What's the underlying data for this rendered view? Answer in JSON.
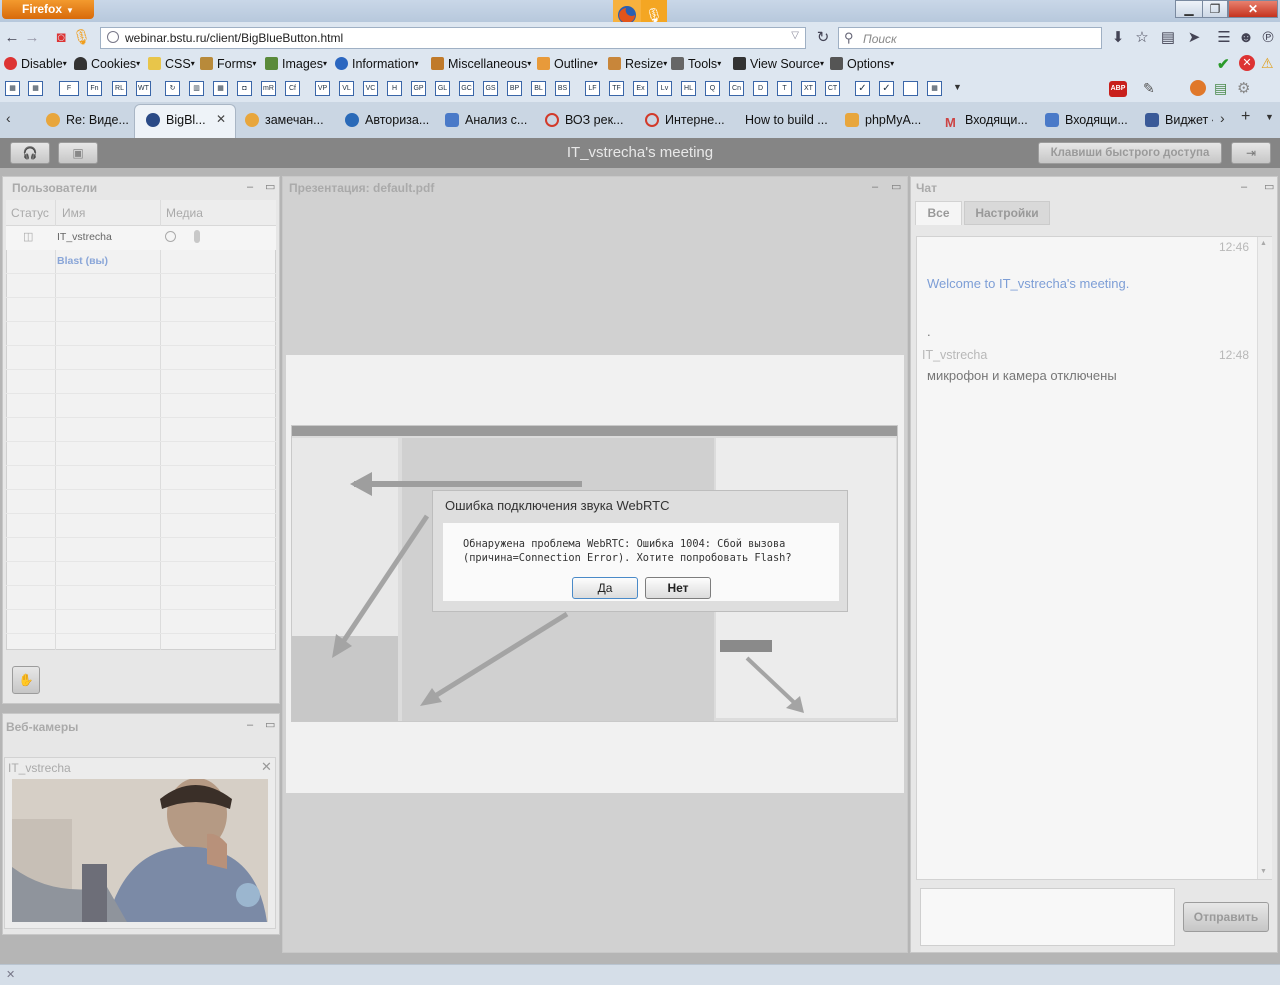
{
  "browser": {
    "firefox_button": "Firefox",
    "url": "webinar.bstu.ru/client/BigBlueButton.html",
    "search_placeholder": "Поиск"
  },
  "webdev_toolbar": {
    "disable": "Disable",
    "cookies": "Cookies",
    "css": "CSS",
    "forms": "Forms",
    "images": "Images",
    "information": "Information",
    "miscellaneous": "Miscellaneous",
    "outline": "Outline",
    "resize": "Resize",
    "tools": "Tools",
    "view_source": "View Source",
    "options": "Options"
  },
  "small_buttons": [
    "F",
    "Fn",
    "RL",
    "WT",
    "",
    "",
    "",
    "mR",
    "Cf",
    "VP",
    "VL",
    "VC",
    "H",
    "GP",
    "GL",
    "GC",
    "GS",
    "BP",
    "BL",
    "BS",
    "LF",
    "TF",
    "Ex",
    "Lv",
    "HL",
    "Q",
    "Cn",
    "D",
    "T",
    "XT",
    "CT"
  ],
  "tabs": [
    {
      "label": "Re: Виде...",
      "color": "#e8a63c"
    },
    {
      "label": "BigBl...",
      "color": "#2a4a86"
    },
    {
      "label": "замечан...",
      "color": "#e8a63c"
    },
    {
      "label": "Авториза...",
      "color": "#2a6ab8"
    },
    {
      "label": "Анализ с...",
      "color": "#4a7ac8"
    },
    {
      "label": "ВОЗ рек...",
      "color": "#d23a2a"
    },
    {
      "label": "Интерне...",
      "color": "#d23a2a"
    },
    {
      "label": "How to build ...",
      "color": ""
    },
    {
      "label": "phpMyA...",
      "color": "#e8a63c"
    },
    {
      "label": "Входящи...",
      "color": "#c44"
    },
    {
      "label": "Входящи...",
      "color": "#4a7ac8"
    },
    {
      "label": "Виджет «",
      "color": "#3a5a98"
    }
  ],
  "app": {
    "meeting_title": "IT_vstrecha's meeting",
    "shortcut_keys": "Клавиши быстрого доступа"
  },
  "users": {
    "title": "Пользователи",
    "col_status": "Статус",
    "col_name": "Имя",
    "col_media": "Медиа",
    "rows": [
      {
        "name": "IT_vstrecha"
      },
      {
        "name": "Blast (вы)"
      }
    ]
  },
  "presentation": {
    "title": "Презентация: default.pdf"
  },
  "chat": {
    "title": "Чат",
    "tab_all": "Все",
    "tab_settings": "Настройки",
    "msg1_time": "12:46",
    "welcome": "Welcome to IT_vstrecha's meeting.",
    "dot": ".",
    "msg2_user": "IT_vstrecha",
    "msg2_time": "12:48",
    "msg2_text": "микрофон и камера отключены",
    "send": "Отправить"
  },
  "webcams": {
    "title": "Веб-камеры",
    "cam_user": "IT_vstrecha"
  },
  "dialog": {
    "title": "Ошибка подключения звука WebRTC",
    "message": "Обнаружена проблема WebRTC: Ошибка 1004: Сбой вызова (причина=Connection Error). Хотите попробовать Flash?",
    "yes": "Да",
    "no": "Нет"
  }
}
